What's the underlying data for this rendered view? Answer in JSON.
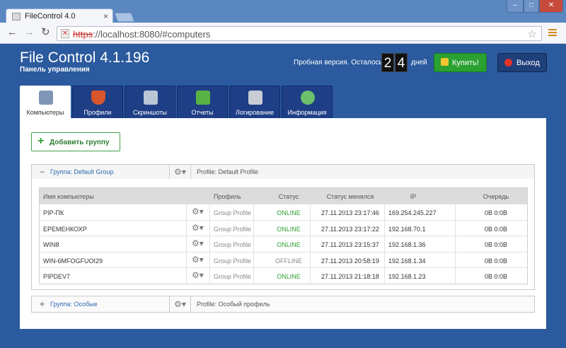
{
  "browser": {
    "tab_title": "FileControl 4.0",
    "tab_close": "×",
    "url_scheme": "https",
    "url_rest": "://localhost:8080/#computers",
    "back": "←",
    "forward": "→",
    "reload": "↻",
    "star": "☆",
    "win_min": "–",
    "win_max": "□",
    "win_close": "✕"
  },
  "header": {
    "title": "File Control 4.1.196",
    "subtitle": "Панель управления",
    "trial_text": "Пробная версия. Осталось",
    "days_digit_1": "2",
    "days_digit_2": "4",
    "days_text": "дней",
    "buy_label": "Купить!",
    "logout_label": "Выход"
  },
  "tabs": [
    {
      "label": "Компьютеры",
      "icon": "computer-icon",
      "color": "#7f96b6"
    },
    {
      "label": "Профили",
      "icon": "shield-icon",
      "color": "#d8562b"
    },
    {
      "label": "Скриншоты",
      "icon": "magnifier-icon",
      "color": "#b8c6d6"
    },
    {
      "label": "Отчеты",
      "icon": "bar-chart-icon",
      "color": "#58b344"
    },
    {
      "label": "Логирование",
      "icon": "log-icon",
      "color": "#c8cdd4"
    },
    {
      "label": "Информация",
      "icon": "gears-icon",
      "color": "#6cc06b"
    }
  ],
  "main": {
    "add_group_label": "Добавить группу",
    "add_group_icon": "+",
    "gear": "⚙▾"
  },
  "groups": [
    {
      "toggle": "−",
      "name": "Группа: Default Group",
      "profile": "Profile: Default Profile",
      "columns": [
        "Имя компьютеры",
        "Профиль",
        "Статус",
        "Статус менялся",
        "IP",
        "Очередь"
      ],
      "rows": [
        {
          "name": "PIP-ПК",
          "profile": "Group Profile",
          "status": "ONLINE",
          "changed": "27.11.2013 23:17:46",
          "ip": "169.254.245.227",
          "queue": "0B 0:0B"
        },
        {
          "name": "ЕРЕМЕНКОХР",
          "profile": "Group Profile",
          "status": "ONLINE",
          "changed": "27.11.2013 23:17:22",
          "ip": "192.168.70.1",
          "queue": "0B 0:0B"
        },
        {
          "name": "WIN8",
          "profile": "Group Profile",
          "status": "ONLINE",
          "changed": "27.11.2013 23:15:37",
          "ip": "192.168.1.36",
          "queue": "0B 0:0B"
        },
        {
          "name": "WIN-6MFOGFUOI29",
          "profile": "Group Profile",
          "status": "OFFLINE",
          "changed": "27.11.2013 20:58:19",
          "ip": "192.168.1.34",
          "queue": "0B 0:0B"
        },
        {
          "name": "PIPDEV7",
          "profile": "Group Profile",
          "status": "ONLINE",
          "changed": "27.11.2013 21:18:18",
          "ip": "192.168.1.23",
          "queue": "0B 0:0B"
        }
      ]
    },
    {
      "toggle": "+",
      "name": "Группа: Особые",
      "profile": "Profile: Особый профиль"
    }
  ],
  "colors": {
    "page_bg": "#2b5a9e",
    "online": "#2aa131",
    "offline": "#888888",
    "buy_button": "#2aa131",
    "logout_button": "#1f3f7a"
  }
}
